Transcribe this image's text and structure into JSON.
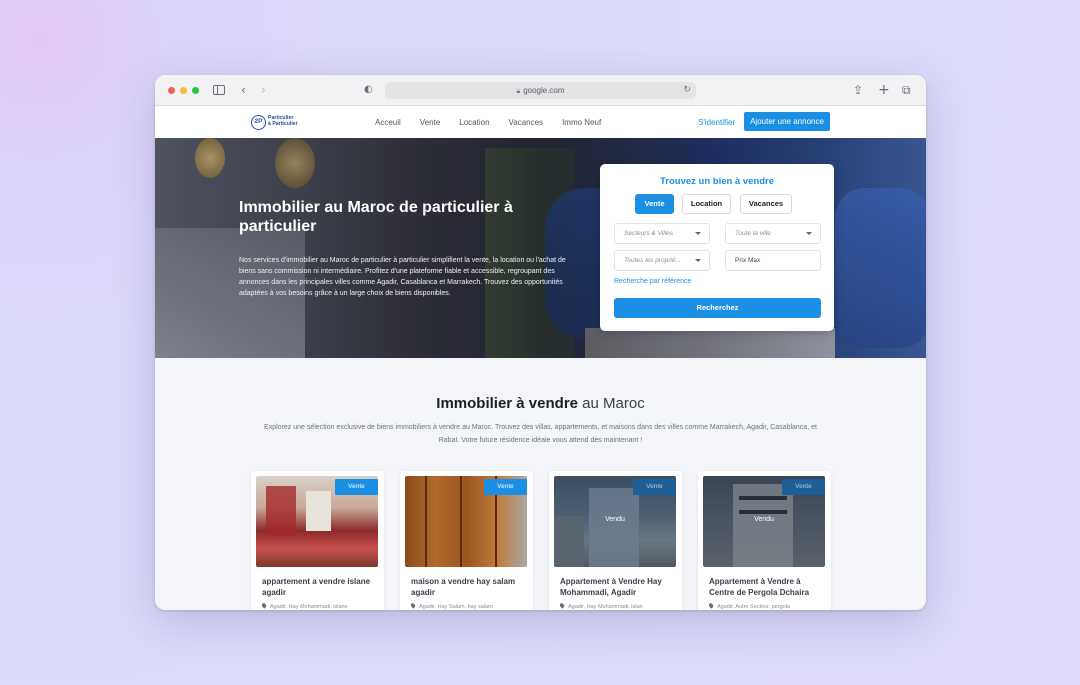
{
  "browser": {
    "url": "google.com"
  },
  "header": {
    "logo_mark": "2P",
    "logo_line1": "Particulier",
    "logo_line2": "à Particulier",
    "nav": [
      "Acceuil",
      "Vente",
      "Location",
      "Vacances",
      "Immo Neuf"
    ],
    "signin": "S'identifier",
    "add_listing": "Ajouter une annonce"
  },
  "hero": {
    "title": "Immobilier au Maroc de particulier à particulier",
    "text": "Nos services d'immobilier au Maroc de particulier à particulier simplifient la vente, la location ou l'achat de biens sans commission ni intermédiaire. Profitez d'une plateforme fiable et accessible, regroupant des annonces dans les principales villes comme Agadir, Casablanca et Marrakech. Trouvez des opportunités adaptées à vos besoins grâce à un large choix de biens disponibles."
  },
  "search": {
    "title": "Trouvez un bien à vendre",
    "tabs": [
      "Vente",
      "Location",
      "Vacances"
    ],
    "sectors_placeholder": "Secteurs & Villes",
    "city_placeholder": "Toute la ville",
    "type_placeholder": "Toutes les proprié...",
    "price_placeholder": "Prix Max",
    "ref_link": "Recherche par référence",
    "button": "Recherchez"
  },
  "section": {
    "title_bold": "Immobilier à vendre",
    "title_light": "au Maroc",
    "description": "Explorez une sélection exclusive de biens immobiliers à vendre au Maroc. Trouvez des villas, appartements, et maisons dans des villes comme Marrakech, Agadir, Casablanca, et Rabat. Votre future résidence idéale vous attend dès maintenant !"
  },
  "listings": [
    {
      "badge": "Vente",
      "sold": "",
      "title": "appartement a vendre islane agadir",
      "location": "Agadir, Hay Mohammadi, islane"
    },
    {
      "badge": "Vente",
      "sold": "",
      "title": "maison a vendre hay salam agadir",
      "location": "Agadir, Hay Salam, hay salam"
    },
    {
      "badge": "Vente",
      "sold": "Vendu",
      "title": "Appartement à Vendre Hay Mohammadi, Agadir",
      "location": "Agadir, Hay Mohammadi, islan"
    },
    {
      "badge": "Vente",
      "sold": "Vendu",
      "title": "Appartement à Vendre à Centre de Pergola Dchaira",
      "location": "Agadir, Autre Secteur, pergola"
    }
  ]
}
